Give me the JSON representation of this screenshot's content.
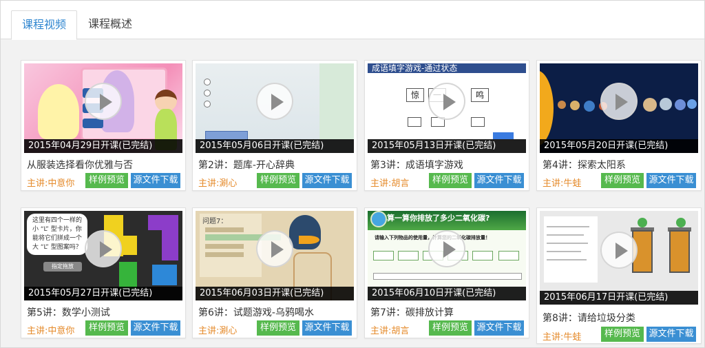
{
  "tabs": [
    {
      "label": "课程视频",
      "active": true
    },
    {
      "label": "课程概述",
      "active": false
    }
  ],
  "colors": {
    "tab_active": "#2f86d0",
    "lecturer": "#e58a2a",
    "preview_btn": "#56b94e",
    "download_btn": "#3a8fd3"
  },
  "icons": {
    "play": "play-circle-icon"
  },
  "courses": [
    {
      "date": "2015年04月29日开课(已完结)",
      "title": "从服装选择看你优雅与否",
      "lecturer": "主讲:中意你",
      "preview": "样例预览",
      "download": "源文件下载"
    },
    {
      "date": "2015年05月06日开课(已完结)",
      "title": "第2讲：题库-开心辞典",
      "lecturer": "主讲:涮心",
      "preview": "样例预览",
      "download": "源文件下载"
    },
    {
      "date": "2015年05月13日开课(已完结)",
      "title": "第3讲：成语填字游戏",
      "lecturer": "主讲:胡言",
      "preview": "样例预览",
      "download": "源文件下载"
    },
    {
      "date": "2015年05月20日开课(已完结)",
      "title": "第4讲：探索太阳系",
      "lecturer": "主讲:牛蛙",
      "preview": "样例预览",
      "download": "源文件下载"
    },
    {
      "date": "2015年05月27日开课(已完结)",
      "title": "第5讲：数学小测试",
      "lecturer": "主讲:中意你",
      "preview": "样例预览",
      "download": "源文件下载"
    },
    {
      "date": "2015年06月03日开课(已完结)",
      "title": "第6讲：试题游戏-乌鸦喝水",
      "lecturer": "主讲:涮心",
      "preview": "样例预览",
      "download": "源文件下载"
    },
    {
      "date": "2015年06月10日开课(已完结)",
      "title": "第7讲：碳排放计算",
      "lecturer": "主讲:胡言",
      "preview": "样例预览",
      "download": "源文件下载"
    },
    {
      "date": "2015年06月17日开课(已完结)",
      "title": "第8讲：请给垃圾分类",
      "lecturer": "主讲:牛蛙",
      "preview": "样例预览",
      "download": "源文件下载"
    }
  ],
  "thumbs": {
    "t3_header": "成语填字游戏-通过状态",
    "t3_chars": [
      "惊",
      "一",
      "鸣"
    ],
    "t5_bubble": [
      "这里有四个一样的",
      "小 “L” 型卡片，你",
      "能将它们拼成一个",
      "大 “L” 型图案吗？"
    ],
    "t5_button": "指定拖放",
    "t6_question": "问题7：",
    "t7_header": "算一算你排放了多少二氧化碳?",
    "t7_sub": "请输入下列物品的使用量，计算您的二氧化碳排放量！"
  }
}
